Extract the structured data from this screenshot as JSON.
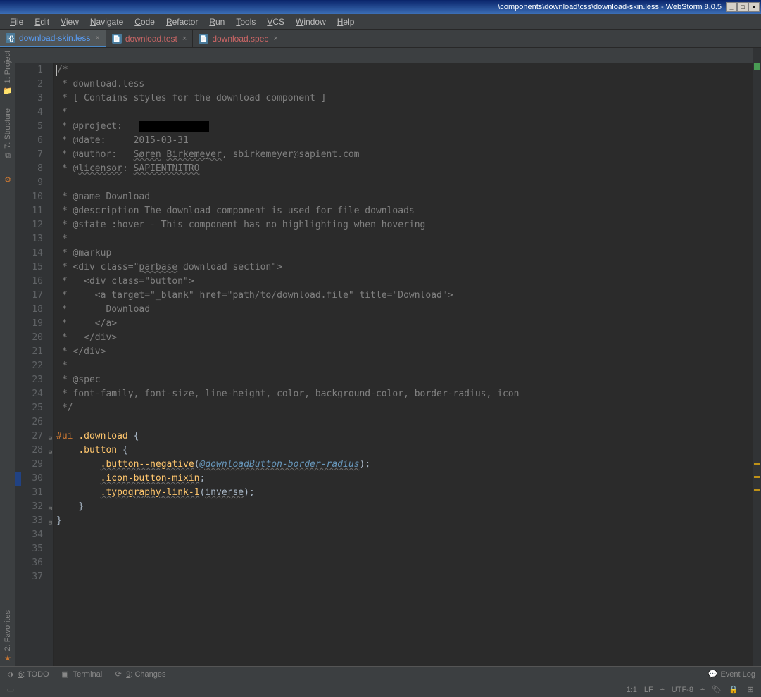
{
  "window": {
    "title": "\\components\\download\\css\\download-skin.less - WebStorm 8.0.5"
  },
  "menus": [
    "File",
    "Edit",
    "View",
    "Navigate",
    "Code",
    "Refactor",
    "Run",
    "Tools",
    "VCS",
    "Window",
    "Help"
  ],
  "tabs": [
    {
      "label": "download-skin.less",
      "icon": "l{}",
      "active": true
    },
    {
      "label": "download.test",
      "icon": "📄",
      "active": false,
      "kind": "test"
    },
    {
      "label": "download.spec",
      "icon": "📄",
      "active": false,
      "kind": "spec"
    }
  ],
  "leftRail": {
    "top": [
      {
        "label": "1: Project",
        "icon": "📁"
      },
      {
        "label": "7: Structure",
        "icon": "⧉"
      }
    ],
    "topLoose": {
      "icon": "⚙"
    },
    "bottom": [
      {
        "label": "2: Favorites",
        "icon": "★"
      }
    ]
  },
  "code": {
    "lines": [
      {
        "n": 1,
        "segs": [
          {
            "t": "/*",
            "c": "c-comment"
          }
        ],
        "caret": true
      },
      {
        "n": 2,
        "segs": [
          {
            "t": " * download.less",
            "c": "c-comment"
          }
        ]
      },
      {
        "n": 3,
        "segs": [
          {
            "t": " * [ Contains styles for the download component ]",
            "c": "c-comment"
          }
        ]
      },
      {
        "n": 4,
        "segs": [
          {
            "t": " *",
            "c": "c-comment"
          }
        ]
      },
      {
        "n": 5,
        "segs": [
          {
            "t": " * @project:   ",
            "c": "c-comment"
          },
          {
            "t": "",
            "c": "blackbox",
            "raw": true
          }
        ]
      },
      {
        "n": 6,
        "segs": [
          {
            "t": " * @date:     2015-03-31",
            "c": "c-comment"
          }
        ]
      },
      {
        "n": 7,
        "segs": [
          {
            "t": " * @author:   ",
            "c": "c-comment"
          },
          {
            "t": "Søren",
            "c": "c-comment c-wave"
          },
          {
            "t": " ",
            "c": "c-comment"
          },
          {
            "t": "Birkemeyer",
            "c": "c-comment c-wave"
          },
          {
            "t": ", sbirkemeyer@sapient.com",
            "c": "c-comment"
          }
        ]
      },
      {
        "n": 8,
        "segs": [
          {
            "t": " * @",
            "c": "c-comment"
          },
          {
            "t": "licensor",
            "c": "c-comment c-wave"
          },
          {
            "t": ": ",
            "c": "c-comment"
          },
          {
            "t": "SAPIENTNITRO",
            "c": "c-comment c-wave"
          }
        ]
      },
      {
        "n": 9,
        "segs": [
          {
            "t": "",
            "c": "c-comment"
          }
        ]
      },
      {
        "n": 10,
        "segs": [
          {
            "t": " * @name Download",
            "c": "c-comment"
          }
        ]
      },
      {
        "n": 11,
        "segs": [
          {
            "t": " * @description The download component is used for file downloads",
            "c": "c-comment"
          }
        ]
      },
      {
        "n": 12,
        "segs": [
          {
            "t": " * @state :hover - This component has no highlighting when hovering",
            "c": "c-comment"
          }
        ]
      },
      {
        "n": 13,
        "segs": [
          {
            "t": " *",
            "c": "c-comment"
          }
        ]
      },
      {
        "n": 14,
        "segs": [
          {
            "t": " * @markup",
            "c": "c-comment"
          }
        ]
      },
      {
        "n": 15,
        "segs": [
          {
            "t": " * <div class=\"",
            "c": "c-comment"
          },
          {
            "t": "parbase",
            "c": "c-comment c-wave"
          },
          {
            "t": " download section\">",
            "c": "c-comment"
          }
        ]
      },
      {
        "n": 16,
        "segs": [
          {
            "t": " *   <div class=\"button\">",
            "c": "c-comment"
          }
        ]
      },
      {
        "n": 17,
        "segs": [
          {
            "t": " *     <a target=\"_blank\" href=\"path/to/download.file\" title=\"Download\">",
            "c": "c-comment"
          }
        ]
      },
      {
        "n": 18,
        "segs": [
          {
            "t": " *       Download",
            "c": "c-comment"
          }
        ]
      },
      {
        "n": 19,
        "segs": [
          {
            "t": " *     </a>",
            "c": "c-comment"
          }
        ]
      },
      {
        "n": 20,
        "segs": [
          {
            "t": " *   </div>",
            "c": "c-comment"
          }
        ]
      },
      {
        "n": 21,
        "segs": [
          {
            "t": " * </div>",
            "c": "c-comment"
          }
        ]
      },
      {
        "n": 22,
        "segs": [
          {
            "t": " *",
            "c": "c-comment"
          }
        ]
      },
      {
        "n": 23,
        "segs": [
          {
            "t": " * @spec",
            "c": "c-comment"
          }
        ]
      },
      {
        "n": 24,
        "segs": [
          {
            "t": " * font-family, font-size, line-height, color, background-color, border-radius, icon",
            "c": "c-comment"
          }
        ]
      },
      {
        "n": 25,
        "segs": [
          {
            "t": " */",
            "c": "c-comment"
          }
        ]
      },
      {
        "n": 26,
        "segs": [
          {
            "t": "",
            "c": ""
          }
        ]
      },
      {
        "n": 27,
        "fold": "⊟",
        "segs": [
          {
            "t": "#ui ",
            "c": "c-sel"
          },
          {
            "t": ".download ",
            "c": "c-sel2"
          },
          {
            "t": "{",
            "c": "c-paren"
          }
        ]
      },
      {
        "n": 28,
        "fold": "⊟",
        "segs": [
          {
            "t": "    ",
            "c": ""
          },
          {
            "t": ".button ",
            "c": "c-sel2"
          },
          {
            "t": "{",
            "c": "c-paren"
          }
        ]
      },
      {
        "n": 29,
        "segs": [
          {
            "t": "        ",
            "c": ""
          },
          {
            "t": ".button--negative",
            "c": "c-sel2 c-wave"
          },
          {
            "t": "(",
            "c": "c-paren"
          },
          {
            "t": "@downloadButton-border-radius",
            "c": "c-var c-wave"
          },
          {
            "t": ")",
            "c": "c-paren"
          },
          {
            "t": ";",
            "c": "c-dot"
          }
        ]
      },
      {
        "n": 30,
        "hl": true,
        "segs": [
          {
            "t": "        ",
            "c": ""
          },
          {
            "t": ".icon-button-mixin",
            "c": "c-sel2 c-wave"
          },
          {
            "t": ";",
            "c": "c-dot"
          }
        ]
      },
      {
        "n": 31,
        "segs": [
          {
            "t": "        ",
            "c": ""
          },
          {
            "t": ".typography-link-1",
            "c": "c-sel2 c-wave"
          },
          {
            "t": "(",
            "c": "c-paren"
          },
          {
            "t": "inverse",
            "c": "c-dot c-wave"
          },
          {
            "t": ")",
            "c": "c-paren"
          },
          {
            "t": ";",
            "c": "c-dot"
          }
        ]
      },
      {
        "n": 32,
        "fold": "⊟",
        "segs": [
          {
            "t": "    ",
            "c": ""
          },
          {
            "t": "}",
            "c": "c-paren"
          }
        ]
      },
      {
        "n": 33,
        "fold": "⊟",
        "segs": [
          {
            "t": "}",
            "c": "c-paren"
          }
        ]
      },
      {
        "n": 34,
        "segs": [
          {
            "t": "",
            "c": ""
          }
        ]
      },
      {
        "n": 35,
        "segs": [
          {
            "t": "",
            "c": ""
          }
        ]
      },
      {
        "n": 36,
        "segs": [
          {
            "t": "",
            "c": ""
          }
        ]
      },
      {
        "n": 37,
        "segs": [
          {
            "t": "",
            "c": ""
          }
        ]
      }
    ]
  },
  "bottomTools": [
    {
      "icon": "⬗",
      "label": "6: TODO",
      "u": "6"
    },
    {
      "icon": "▣",
      "label": "Terminal"
    },
    {
      "icon": "⟳",
      "label": "9: Changes",
      "u": "9"
    }
  ],
  "status": {
    "eventLog": "Event Log",
    "pos": "1:1",
    "le": "LF",
    "enc": "UTF-8"
  }
}
